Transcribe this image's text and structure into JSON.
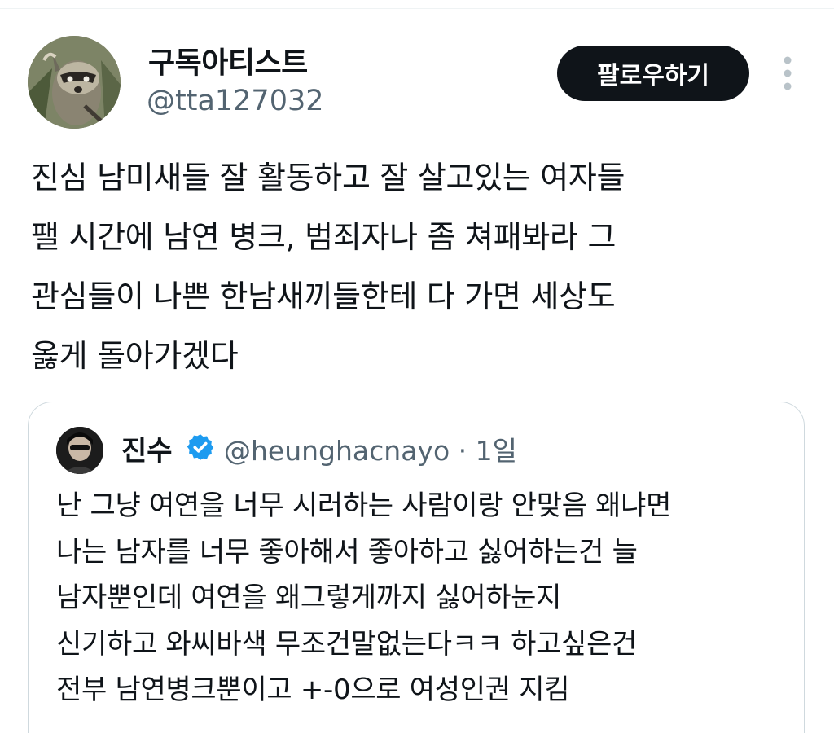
{
  "tweet": {
    "author": {
      "display_name": "구독아티스트",
      "handle": "@tta127032",
      "avatar_icon": "raccoon-avatar"
    },
    "follow_label": "팔로우하기",
    "more_icon": "more-vertical-icon",
    "text_lines": [
      "진심 남미새들 잘 활동하고 잘 살고있는 여자들",
      "팰 시간에 남연 병크, 범죄자나 좀 쳐패봐라 그",
      "관심들이 나쁜 한남새끼들한테 다 가면 세상도",
      "옳게 돌아가겠다"
    ]
  },
  "quote": {
    "author": {
      "display_name": "진수",
      "handle": "@heunghacnayo",
      "separator": "·",
      "time": "1일",
      "verified_icon": "verified-badge-icon",
      "verified_color": "#1d9bf0"
    },
    "text_lines": [
      "난 그냥 여연을 너무 시러하는 사람이랑 안맞음 왜냐면",
      "나는 남자를 너무 좋아해서 좋아하고 싫어하는건 늘",
      "남자뿐인데 여연을 왜그렇게까지 싫어하눈지",
      "신기하고 와씨바색 무조건말없는다ㅋㅋ 하고싶은건",
      "전부 남연병크뿐이고 +-0으로 여성인권 지킴"
    ]
  },
  "colors": {
    "text": "#0f1419",
    "secondary_text": "#536471",
    "follow_button_bg": "#0f1419",
    "border": "#cfd9de"
  }
}
